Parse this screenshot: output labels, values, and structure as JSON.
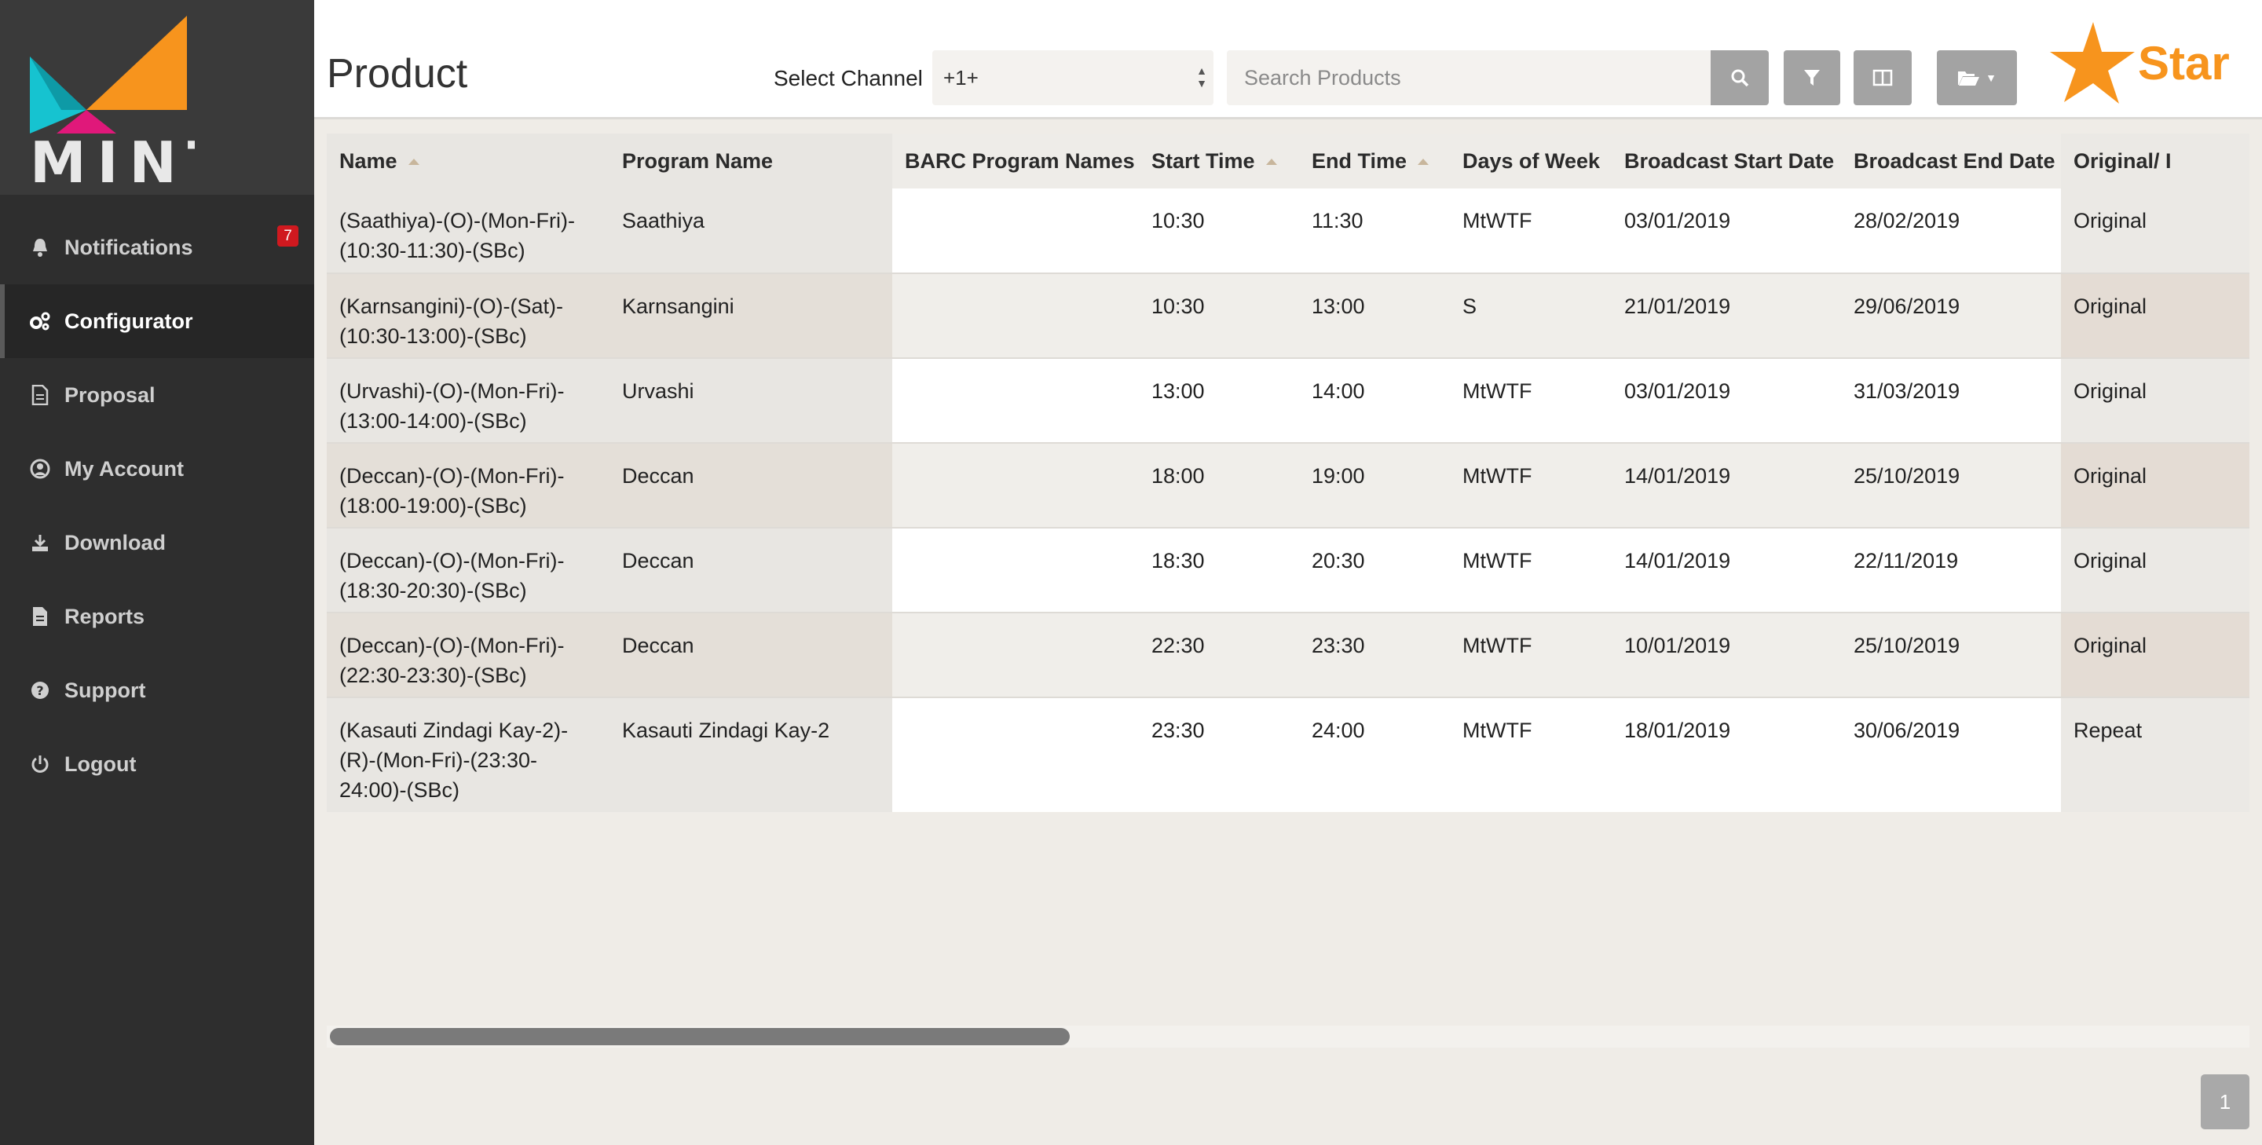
{
  "app": {
    "logo_text": "MINT"
  },
  "sidebar": {
    "notification_count": "7",
    "items": [
      {
        "label": "Notifications",
        "icon": "bell-icon"
      },
      {
        "label": "Configurator",
        "icon": "gears-icon",
        "active": true
      },
      {
        "label": "Proposal",
        "icon": "document-icon"
      },
      {
        "label": "My Account",
        "icon": "user-circle-icon"
      },
      {
        "label": "Download",
        "icon": "download-icon"
      },
      {
        "label": "Reports",
        "icon": "report-icon"
      },
      {
        "label": "Support",
        "icon": "question-circle-icon"
      },
      {
        "label": "Logout",
        "icon": "power-icon"
      }
    ]
  },
  "header": {
    "title": "Product",
    "channel_label": "Select Channel",
    "channel_value": "+1+",
    "search_placeholder": "Search Products",
    "brand_text": "Star",
    "brand_color": "#f7941d"
  },
  "table": {
    "columns": [
      "Name",
      "Program Name",
      "BARC Program Names",
      "Start Time",
      "End Time",
      "Days of Week",
      "Broadcast Start Date",
      "Broadcast End Date",
      "Original/ I"
    ],
    "rows": [
      [
        "(Saathiya)-(O)-(Mon-Fri)-(10:30-11:30)-(SBc)",
        "Saathiya",
        "",
        "10:30",
        "11:30",
        "MtWTF",
        "03/01/2019",
        "28/02/2019",
        "Original"
      ],
      [
        "(Karnsangini)-(O)-(Sat)-(10:30-13:00)-(SBc)",
        "Karnsangini",
        "",
        "10:30",
        "13:00",
        "S",
        "21/01/2019",
        "29/06/2019",
        "Original"
      ],
      [
        "(Urvashi)-(O)-(Mon-Fri)-(13:00-14:00)-(SBc)",
        "Urvashi",
        "",
        "13:00",
        "14:00",
        "MtWTF",
        "03/01/2019",
        "31/03/2019",
        "Original"
      ],
      [
        "(Deccan)-(O)-(Mon-Fri)-(18:00-19:00)-(SBc)",
        "Deccan",
        "",
        "18:00",
        "19:00",
        "MtWTF",
        "14/01/2019",
        "25/10/2019",
        "Original"
      ],
      [
        "(Deccan)-(O)-(Mon-Fri)-(18:30-20:30)-(SBc)",
        "Deccan",
        "",
        "18:30",
        "20:30",
        "MtWTF",
        "14/01/2019",
        "22/11/2019",
        "Original"
      ],
      [
        "(Deccan)-(O)-(Mon-Fri)-(22:30-23:30)-(SBc)",
        "Deccan",
        "",
        "22:30",
        "23:30",
        "MtWTF",
        "10/01/2019",
        "25/10/2019",
        "Original"
      ],
      [
        "(Kasauti Zindagi Kay-2)-(R)-(Mon-Fri)-(23:30-24:00)-(SBc)",
        "Kasauti Zindagi Kay-2",
        "",
        "23:30",
        "24:00",
        "MtWTF",
        "18/01/2019",
        "30/06/2019",
        "Repeat"
      ]
    ]
  },
  "scrollbar": {
    "visible_fraction": 0.385
  },
  "pagination": {
    "current_page": "1"
  }
}
